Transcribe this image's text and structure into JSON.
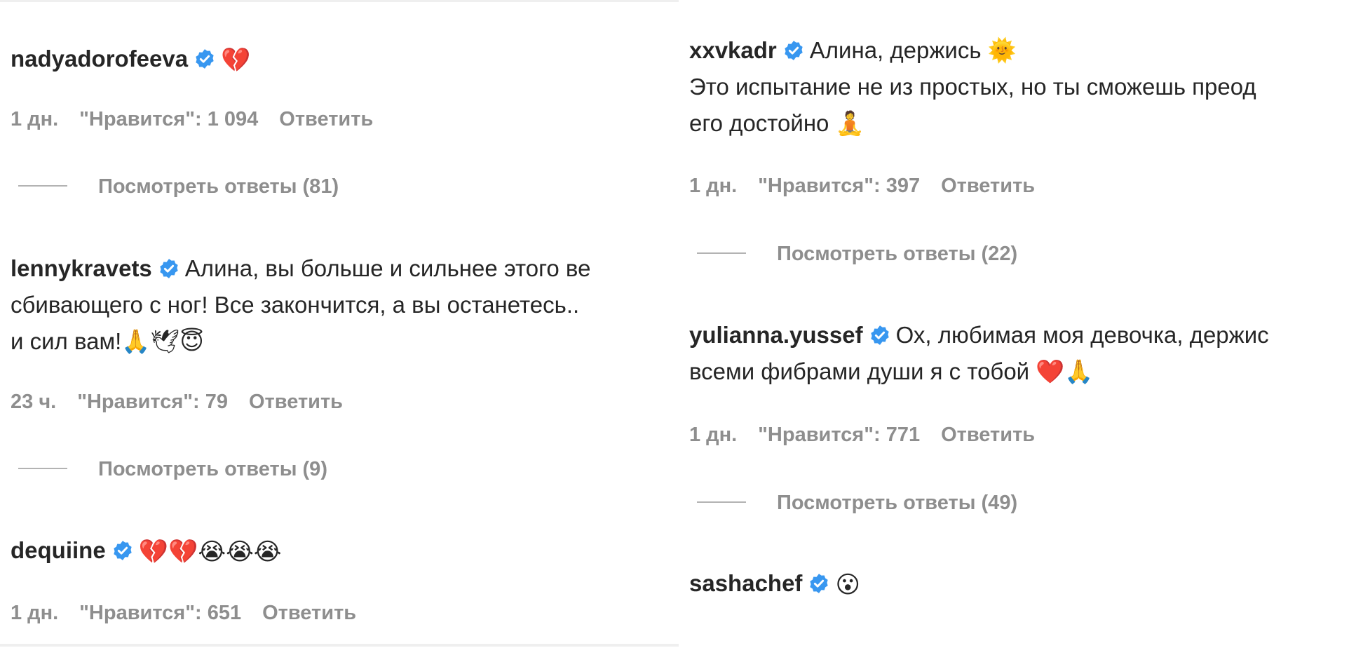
{
  "left": {
    "comments": [
      {
        "username": "nadyadorofeeva",
        "lines": [
          "💔"
        ],
        "time": "1 дн.",
        "likes": "\"Нравится\": 1 094",
        "reply": "Ответить",
        "view_replies": "Посмотреть ответы (81)"
      },
      {
        "username": "lennykravets",
        "lines": [
          "Алина, вы больше и сильнее этого ве",
          "сбивающего с ног! Все закончится, а вы останетесь..",
          "и сил вам!🙏🕊😇"
        ],
        "time": "23 ч.",
        "likes": "\"Нравится\": 79",
        "reply": "Ответить",
        "view_replies": "Посмотреть ответы (9)"
      },
      {
        "username": "dequiine",
        "lines": [
          "💔💔😭😭😭"
        ],
        "time": "1 дн.",
        "likes": "\"Нравится\": 651",
        "reply": "Ответить"
      }
    ]
  },
  "right": {
    "comments": [
      {
        "username": "xxvkadr",
        "lines": [
          "Алина, держись 🌞",
          "Это испытание не из простых, но ты сможешь преод",
          "его достойно 🧘"
        ],
        "time": "1 дн.",
        "likes": "\"Нравится\": 397",
        "reply": "Ответить",
        "view_replies": "Посмотреть ответы (22)"
      },
      {
        "username": "yulianna.yussef",
        "lines": [
          "Ох, любимая моя девочка, держис",
          "всеми фибрами души я с тобой ❤️🙏"
        ],
        "time": "1 дн.",
        "likes": "\"Нравится\": 771",
        "reply": "Ответить",
        "view_replies": "Посмотреть ответы (49)"
      },
      {
        "username": "sashachef",
        "lines": [
          "😮"
        ]
      }
    ]
  },
  "colors": {
    "verified_badge": "#3897f0",
    "text": "#262626",
    "secondary": "#8e8e8e"
  },
  "icons": {
    "verified": "verified-badge-icon"
  }
}
